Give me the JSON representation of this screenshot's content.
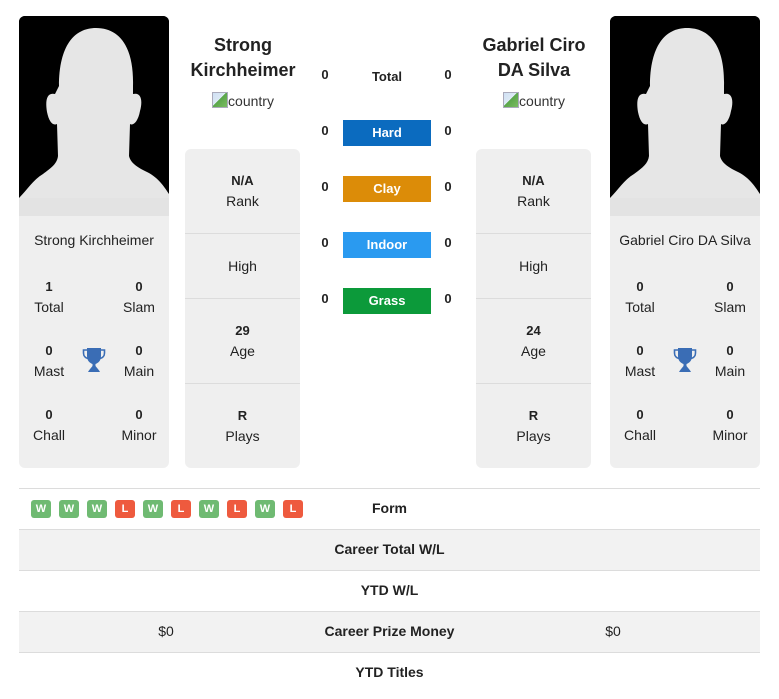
{
  "colors": {
    "hard": "#0b6bbf",
    "clay": "#dc8c08",
    "indoor": "#2a9af0",
    "grass": "#0c9a3a",
    "win": "#6fba72",
    "loss": "#ee5a3e",
    "trophy": "#3a6db5"
  },
  "player1": {
    "name": "Strong Kirchheimer",
    "name_line1": "Strong",
    "name_line2": "Kirchheimer",
    "flag_alt": "country",
    "card_name": "Strong Kirchheimer",
    "titles": {
      "total": {
        "value": "1",
        "label": "Total"
      },
      "slam": {
        "value": "0",
        "label": "Slam"
      },
      "mast": {
        "value": "0",
        "label": "Mast"
      },
      "main": {
        "value": "0",
        "label": "Main"
      },
      "chall": {
        "value": "0",
        "label": "Chall"
      },
      "minor": {
        "value": "0",
        "label": "Minor"
      }
    },
    "info": {
      "rank": {
        "value": "N/A",
        "label": "Rank"
      },
      "high": {
        "value": "",
        "label": "High"
      },
      "age": {
        "value": "29",
        "label": "Age"
      },
      "plays": {
        "value": "R",
        "label": "Plays"
      }
    },
    "form": [
      "W",
      "W",
      "W",
      "L",
      "W",
      "L",
      "W",
      "L",
      "W",
      "L"
    ],
    "career_prize_money": "$0"
  },
  "player2": {
    "name": "Gabriel Ciro DA Silva",
    "name_line1": "Gabriel Ciro",
    "name_line2": "DA Silva",
    "flag_alt": "country",
    "card_name": "Gabriel Ciro DA Silva",
    "titles": {
      "total": {
        "value": "0",
        "label": "Total"
      },
      "slam": {
        "value": "0",
        "label": "Slam"
      },
      "mast": {
        "value": "0",
        "label": "Mast"
      },
      "main": {
        "value": "0",
        "label": "Main"
      },
      "chall": {
        "value": "0",
        "label": "Chall"
      },
      "minor": {
        "value": "0",
        "label": "Minor"
      }
    },
    "info": {
      "rank": {
        "value": "N/A",
        "label": "Rank"
      },
      "high": {
        "value": "",
        "label": "High"
      },
      "age": {
        "value": "24",
        "label": "Age"
      },
      "plays": {
        "value": "R",
        "label": "Plays"
      }
    },
    "career_prize_money": "$0"
  },
  "h2h": {
    "total": {
      "label": "Total",
      "p1": "0",
      "p2": "0"
    },
    "surfaces": [
      {
        "label": "Hard",
        "p1": "0",
        "p2": "0",
        "color_key": "hard"
      },
      {
        "label": "Clay",
        "p1": "0",
        "p2": "0",
        "color_key": "clay"
      },
      {
        "label": "Indoor",
        "p1": "0",
        "p2": "0",
        "color_key": "indoor"
      },
      {
        "label": "Grass",
        "p1": "0",
        "p2": "0",
        "color_key": "grass"
      }
    ]
  },
  "table": {
    "form_label": "Form",
    "career_total_wl_label": "Career Total W/L",
    "ytd_wl_label": "YTD W/L",
    "career_prize_money_label": "Career Prize Money",
    "ytd_titles_label": "YTD Titles"
  },
  "icons": {
    "photo": "player-silhouette-icon",
    "flag": "broken-image-icon",
    "trophy": "trophy-icon"
  }
}
